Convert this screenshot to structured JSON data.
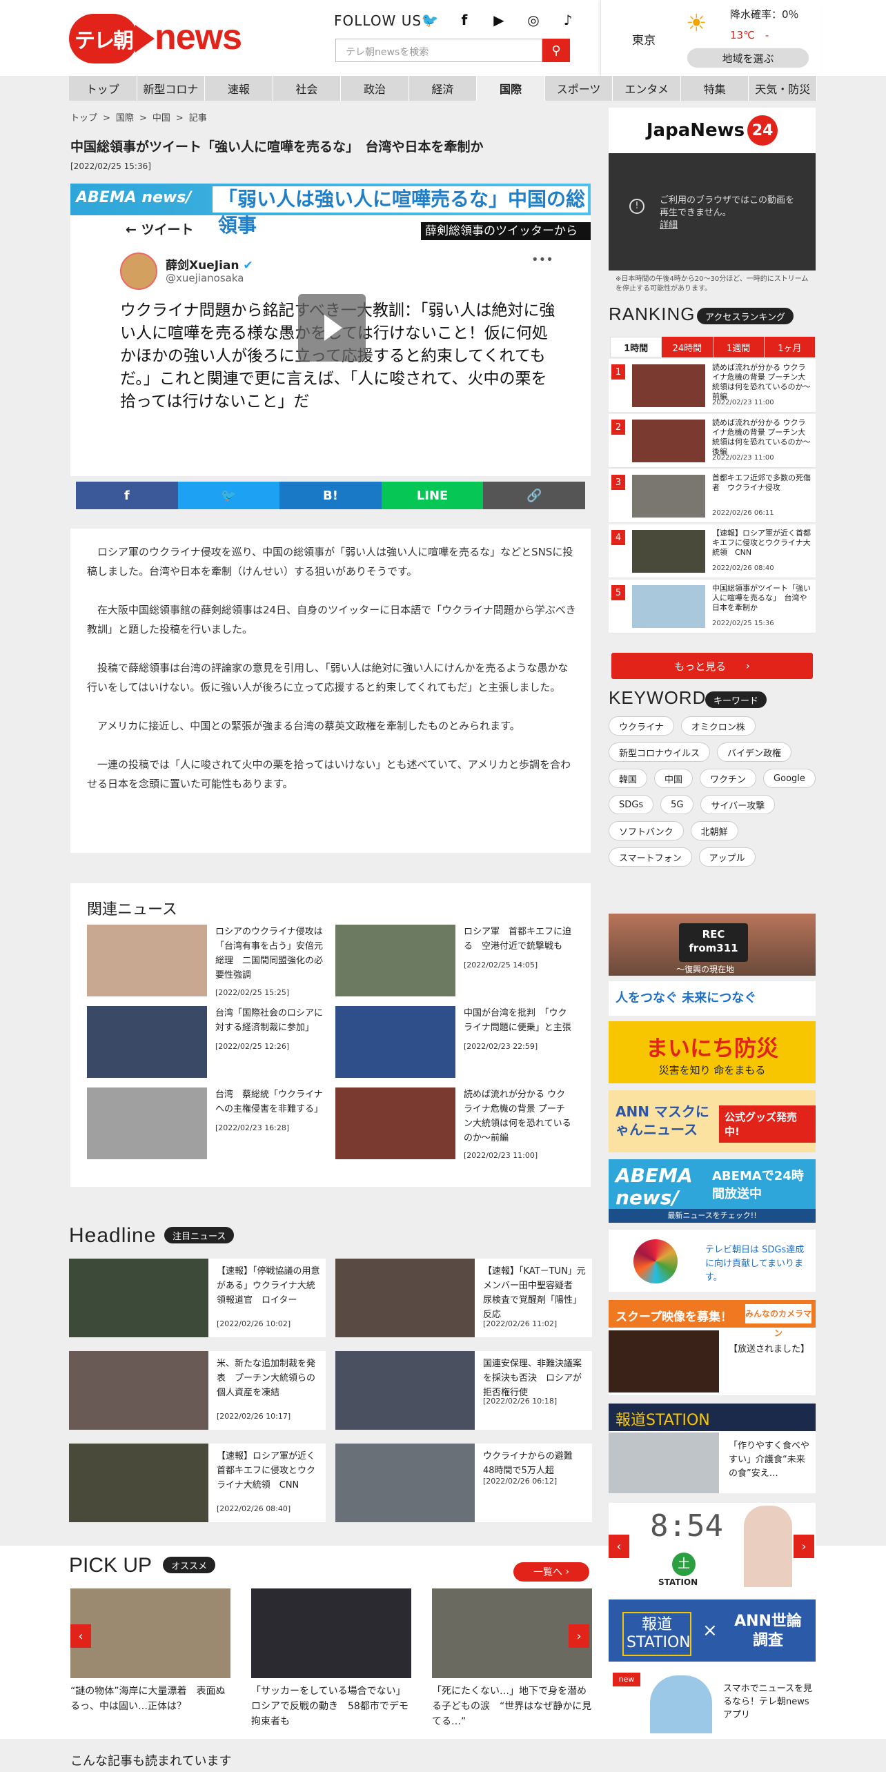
{
  "brand": {
    "badge": "テレ朝",
    "news": "news"
  },
  "follow": "FOLLOW US",
  "sns_icons": [
    "twitter-icon",
    "facebook-icon",
    "youtube-icon",
    "instagram-icon",
    "tiktok-icon"
  ],
  "search": {
    "placeholder": "テレ朝newsを検索"
  },
  "weather": {
    "city": "東京",
    "rain": "降水確率：0％",
    "temp": "13℃　-",
    "region": "地域を選ぶ"
  },
  "nav": [
    "トップ",
    "新型コロナ",
    "速報",
    "社会",
    "政治",
    "経済",
    "国際",
    "スポーツ",
    "エンタメ",
    "特集",
    "天気・防災"
  ],
  "nav_active": "国際",
  "breadcrumb": [
    "トップ",
    ">",
    "国際",
    ">",
    "中国",
    ">",
    "記事"
  ],
  "article": {
    "title": "中国総領事がツイート「強い人に喧嘩を売るな」　台湾や日本を牽制か",
    "date": "[2022/02/25 15:36]",
    "video": {
      "label": "ABEMA news/",
      "headline": "「弱い人は強い人に喧嘩売るな」中国の総領事",
      "caption": "薛剣総領事のツイッターから",
      "tweet_header": "ツイート",
      "user": "薛剑XueJian",
      "handle": "@xuejianosaka",
      "text": "ウクライナ問題から銘記すべき一大教訓：「弱い人は絶対に強い人に喧嘩を売る様な愚かをしては行けないこと！仮に何処かほかの強い人が後ろに立って応援すると約束してくれてもだ。」これと関連で更に言えば、「人に唆されて、火中の栗を拾っては行けないこと」だ"
    },
    "share": [
      {
        "label": "f",
        "color": "#3b5998"
      },
      {
        "label": "🐦",
        "color": "#1da1f2"
      },
      {
        "label": "B!",
        "color": "#1a79c7"
      },
      {
        "label": "LINE",
        "color": "#06c755"
      },
      {
        "label": "🔗",
        "color": "#555555"
      }
    ],
    "paragraphs": [
      "ロシア軍のウクライナ侵攻を巡り、中国の総領事が「弱い人は強い人に喧嘩を売るな」などとSNSに投稿しました。台湾や日本を牽制（けんせい）する狙いがありそうです。",
      "在大阪中国総領事館の薛剣総領事は24日、自身のツイッターに日本語で「ウクライナ問題から学ぶべき教訓」と題した投稿を行いました。",
      "投稿で薛総領事は台湾の評論家の意見を引用し、「弱い人は絶対に強い人にけんかを売るような愚かな行いをしてはいけない。仮に強い人が後ろに立って応援すると約束してくれてもだ」と主張しました。",
      "アメリカに接近し、中国との緊張が強まる台湾の蔡英文政権を牽制したものとみられます。",
      "一連の投稿では「人に唆されて火中の栗を拾ってはいけない」とも述べていて、アメリカと歩調を合わせる日本を念頭に置いた可能性もあります。"
    ]
  },
  "related": {
    "title": "関連ニュース",
    "items": [
      {
        "title": "ロシアのウクライナ侵攻は「台湾有事を占う」安倍元総理　二国間同盟強化の必要性強調",
        "date": "[2022/02/25 15:25]",
        "color": "#c8a890"
      },
      {
        "title": "ロシア軍　首都キエフに迫る　空港付近で銃撃戦も",
        "date": "[2022/02/25 14:05]",
        "color": "#6b7a60"
      },
      {
        "title": "台湾「国際社会のロシアに対する経済制裁に参加」",
        "date": "[2022/02/25 12:26]",
        "color": "#3a4a66"
      },
      {
        "title": "中国が台湾を批判　「ウクライナ問題に便乗」と主張",
        "date": "[2022/02/23 22:59]",
        "color": "#2f4f8a"
      },
      {
        "title": "台湾　蔡総統「ウクライナへの主権侵害を非難する」",
        "date": "[2022/02/23 16:28]",
        "color": "#a0a0a0"
      },
      {
        "title": "読めば流れが分かる ウクライナ危機の背景 プーチン大統領は何を恐れているのか～前編",
        "date": "[2022/02/23 11:00]",
        "color": "#7a3a30"
      }
    ]
  },
  "headline": {
    "title": "Headline",
    "badge": "注目ニュース",
    "items": [
      {
        "title": "【速報】「停戦協議の用意がある」ウクライナ大統領報道官　ロイター",
        "date": "[2022/02/26 10:02]",
        "color": "#3d4a3a"
      },
      {
        "title": "【速報】「KAT－TUN」元メンバー田中聖容疑者　尿検査で覚醒剤「陽性」反応",
        "date": "[2022/02/26 11:02]",
        "color": "#5a4a44"
      },
      {
        "title": "米、新たな追加制裁を発表　プーチン大統領らの個人資産を凍結",
        "date": "[2022/02/26 10:17]",
        "color": "#6a5a55"
      },
      {
        "title": "国連安保理、非難決議案を採決も否決　ロシアが拒否権行使",
        "date": "[2022/02/26 10:18]",
        "color": "#4a5060"
      },
      {
        "title": "【速報】ロシア軍が近く首都キエフに侵攻とウクライナ大統領　CNN",
        "date": "[2022/02/26 08:40]",
        "color": "#4a4a3a"
      },
      {
        "title": "ウクライナからの避難　48時間で5万人超",
        "date": "[2022/02/26 06:12]",
        "color": "#6a7078"
      }
    ]
  },
  "pickup": {
    "title": "PICK UP",
    "badge": "オススメ",
    "all": "一覧へ",
    "items": [
      {
        "title": "“謎の物体”海岸に大量漂着　表面ぬるっ、中は固い…正体は？",
        "color": "#9c8a70"
      },
      {
        "title": "「サッカーをしている場合でない」ロシアで反戦の動き　58都市でデモ拘束者も",
        "color": "#2a2a30"
      },
      {
        "title": "「死にたくない…」地下で身を潜める子どもの涙　“世界はなぜ静かに見てる…”",
        "color": "#6a6a60"
      }
    ]
  },
  "also_read": "こんな記事も読まれています",
  "sidebar": {
    "japanews": {
      "name": "JapaNews",
      "num": "24"
    },
    "video_msg": "ご利用のブラウザではこの動画を再生できません。",
    "video_link": "詳細",
    "note": "※日本時間の午後4時から20～30分ほど、一時的にストリームを停止する可能性があります。",
    "ranking": {
      "title": "RANKING",
      "badge": "アクセスランキング",
      "tabs": [
        "1時間",
        "24時間",
        "1週間",
        "1ヶ月"
      ],
      "items": [
        {
          "n": "1",
          "title": "読めば流れが分かる ウクライナ危機の背景 プーチン大統領は何を恐れているのか～前編",
          "date": "2022/02/23 11:00",
          "color": "#7a3a30"
        },
        {
          "n": "2",
          "title": "読めば流れが分かる ウクライナ危機の背景 プーチン大統領は何を恐れているのか～後編",
          "date": "2022/02/23 11:00",
          "color": "#7a3a30"
        },
        {
          "n": "3",
          "title": "首都キエフ近郊で多数の死傷者　ウクライナ侵攻",
          "date": "2022/02/26 06:11",
          "color": "#7a7670"
        },
        {
          "n": "4",
          "title": "【速報】ロシア軍が近く首都キエフに侵攻とウクライナ大統領　CNN",
          "date": "2022/02/26 08:40",
          "color": "#4a4a3a"
        },
        {
          "n": "5",
          "title": "中国総領事がツイート「強い人に喧嘩を売るな」　台湾や日本を牽制か",
          "date": "2022/02/25 15:36",
          "color": "#aac8dc"
        }
      ],
      "more": "もっと見る"
    },
    "keyword": {
      "title": "KEYWORD",
      "badge": "キーワード",
      "items": [
        "ウクライナ",
        "オミクロン株",
        "新型コロナウイルス",
        "バイデン政権",
        "韓国",
        "中国",
        "ワクチン",
        "Google",
        "SDGs",
        "5G",
        "サイバー攻撃",
        "ソフトバンク",
        "北朝鮮",
        "スマートフォン",
        "アップル"
      ]
    },
    "banners": {
      "rec": "REC from311",
      "rec_sub": "～復興の現在地",
      "sdgs": "人をつなぐ 未来につなぐ",
      "bousai": "まいにち防災",
      "bousai_sub": "災害を知り 命をまもる",
      "mask": "ANN マスクにゃんニュース",
      "mask_sub": "公式グッズ発売中!",
      "abema1": "ABEMA news/",
      "abema2": "ABEMAで24時間放送中",
      "abema3": "最新ニュースをチェック!!",
      "sdgs2": "テレビ朝日は SDGs達成に向け貢献してまいります。",
      "scoop": "スクープ映像を募集！",
      "scoop_logo": "みんなのカメラマン",
      "scoop_item": "【放送されました】",
      "houdou": "報道STATION",
      "houdou_item": "「作りやすく食べやすい」介護食“未来の食”安え…",
      "clock": "8:54",
      "clock_day": "土",
      "station": "STATION",
      "survey1": "報道STATION",
      "survey2": "ANN世論調査",
      "app": "スマホでニュースを見るなら！テレ朝newsアプリ"
    }
  }
}
